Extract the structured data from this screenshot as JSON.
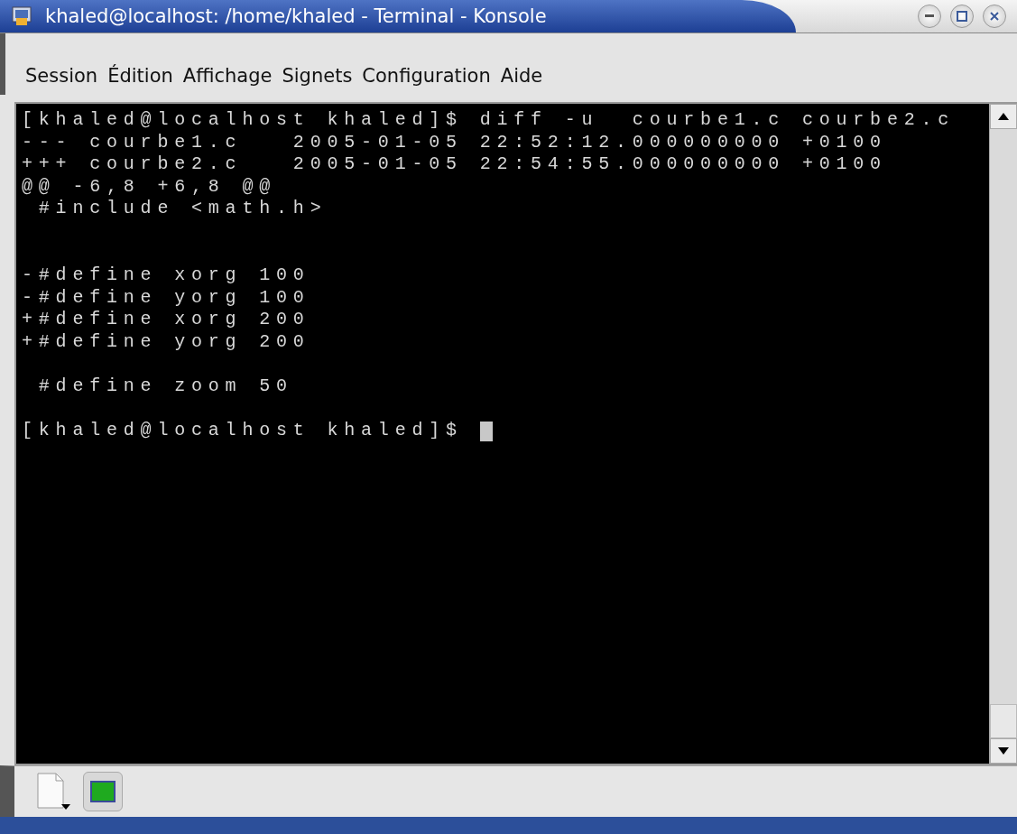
{
  "window": {
    "title": "khaled@localhost: /home/khaled - Terminal - Konsole"
  },
  "menu": [
    "Session",
    "Édition",
    "Affichage",
    "Signets",
    "Configuration",
    "Aide"
  ],
  "terminal": {
    "lines": [
      {
        "kind": "output",
        "text": "[khaled@localhost khaled]$ diff -u  courbe1.c courbe2.c"
      },
      {
        "kind": "output",
        "text": "--- courbe1.c   2005-01-05 22:52:12.000000000 +0100"
      },
      {
        "kind": "output",
        "text": "+++ courbe2.c   2005-01-05 22:54:55.000000000 +0100"
      },
      {
        "kind": "output",
        "text": "@@ -6,8 +6,8 @@"
      },
      {
        "kind": "output",
        "text": " #include <math.h>"
      },
      {
        "kind": "blank"
      },
      {
        "kind": "blank"
      },
      {
        "kind": "output",
        "text": "-#define xorg 100"
      },
      {
        "kind": "output",
        "text": "-#define yorg 100"
      },
      {
        "kind": "output",
        "text": "+#define xorg 200"
      },
      {
        "kind": "output",
        "text": "+#define yorg 200"
      },
      {
        "kind": "blank"
      },
      {
        "kind": "output",
        "text": " #define zoom 50"
      },
      {
        "kind": "blank"
      },
      {
        "kind": "prompt",
        "text": "[khaled@localhost khaled]$ "
      }
    ]
  }
}
